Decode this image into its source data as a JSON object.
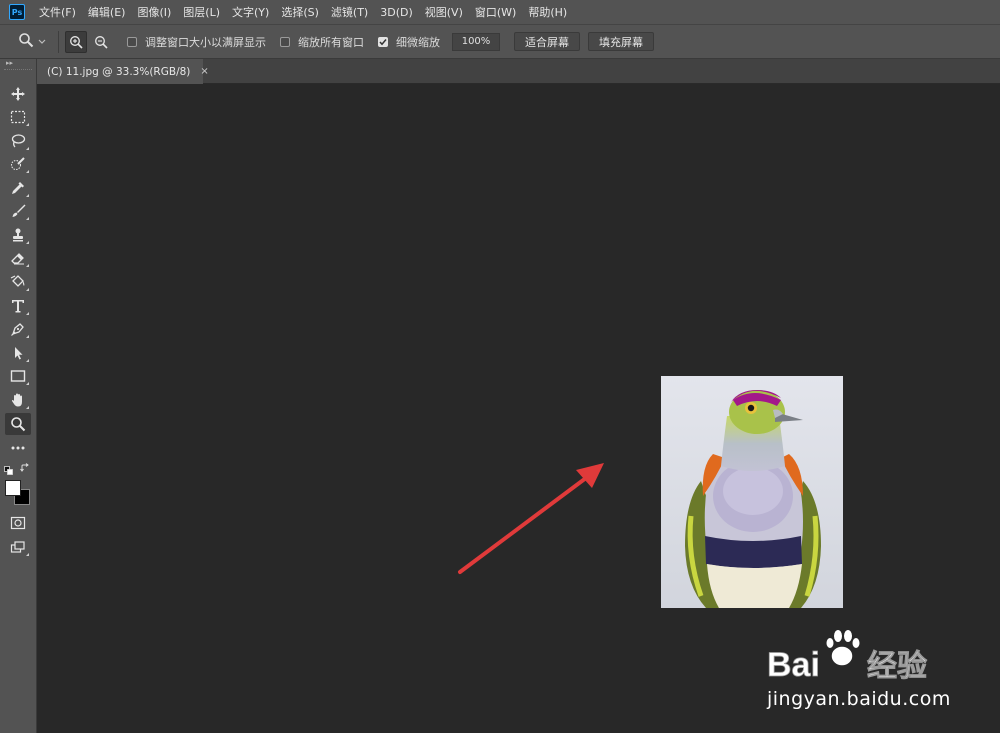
{
  "app": {
    "logo_text": "Ps"
  },
  "menu": {
    "items": [
      "文件(F)",
      "编辑(E)",
      "图像(I)",
      "图层(L)",
      "文字(Y)",
      "选择(S)",
      "滤镜(T)",
      "3D(D)",
      "视图(V)",
      "窗口(W)",
      "帮助(H)"
    ]
  },
  "options": {
    "resize_windows_label": "调整窗口大小以满屏显示",
    "resize_windows_checked": false,
    "zoom_all_windows_label": "缩放所有窗口",
    "zoom_all_windows_checked": false,
    "scrubby_zoom_label": "细微缩放",
    "scrubby_zoom_checked": true,
    "percent_button": "100%",
    "fit_screen_button": "适合屏幕",
    "fill_screen_button": "填充屏幕"
  },
  "document_tab": {
    "title": "(C) 11.jpg @ 33.3%(RGB/8)",
    "close_symbol": "×"
  },
  "tools": [
    "move-tool",
    "marquee-tool",
    "lasso-tool",
    "quick-selection-tool",
    "eyedropper-tool",
    "brush-tool",
    "clone-stamp-tool",
    "eraser-tool",
    "paint-bucket-tool",
    "type-tool",
    "pen-tool",
    "path-selection-tool",
    "rectangle-tool",
    "hand-tool",
    "zoom-tool",
    "more-tools"
  ],
  "colors": {
    "foreground": "#ffffff",
    "background": "#000000",
    "accent": "#31a8ff",
    "arrow": "#e03a3a",
    "canvas_bg": "#282828",
    "panel_bg": "#535353"
  },
  "watermark": {
    "logo_text": "Bai",
    "logo_text_cn": "经验",
    "url": "jingyan.baidu.com"
  }
}
